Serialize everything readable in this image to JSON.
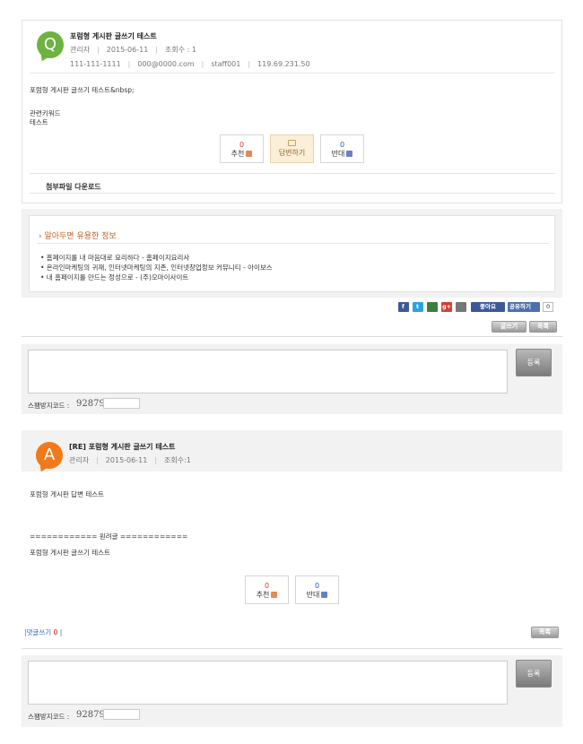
{
  "question": {
    "avatar_letter": "Q",
    "avatar_color": "#6db33f",
    "title": "포럼형 게시판 글쓰기 테스트",
    "author": "관리자",
    "date": "2015-06-11",
    "views": "조회수 : 1",
    "phone": "111-111-1111",
    "email": "000@0000.com",
    "user_id": "staff001",
    "ip": "119.69.231.50",
    "body_line1": "포럼형 게시판 글쓰기 테스트&nbsp;",
    "keywords_label": "관련키워드",
    "keywords_value": "테스트",
    "recommend_count": "0",
    "recommend_label": "추천",
    "reply_label": "답변하기",
    "oppose_count": "0",
    "oppose_label": "반대",
    "attachment_label": "첨부파일 다운로드"
  },
  "info": {
    "title": "› 알아두면 유용한 정보",
    "items": [
      "• 홈페이지를 내 마음대로 요리하다 - 홈페이지요리사",
      "• 온라인마케팅의 귀재, 인터넷마케팅의 지존, 인터넷창업정보 커뮤니티 - 아이보스",
      "• 내 홈페이지를 만드는 정성으로 - (주)오마이사이트"
    ]
  },
  "share": {
    "facebook": "f",
    "twitter": "t",
    "google": "g+",
    "like_label": "좋아요",
    "share_label": "공유하기",
    "share_count": "0",
    "colors": {
      "facebook": "#3b5998",
      "twitter": "#2aa3e0",
      "google": "#d44132",
      "like": "#3b5998",
      "share": "#4d6fad"
    }
  },
  "buttons": {
    "write": "글쓰기",
    "list": "목록",
    "submit": "등록"
  },
  "comment_form": {
    "spam_label": "스팸방지코드 :",
    "spam_code": "92879"
  },
  "answer": {
    "avatar_letter": "A",
    "avatar_color": "#f07a1a",
    "title": "[RE] 포럼형 게시판 글쓰기 테스트",
    "author": "관리자",
    "date": "2015-06-11",
    "views": "조회수:1",
    "body_line1": "포럼형 게시판 답변 테스트",
    "separator": "============ 원려글 ============",
    "original_text": "포럼형 게시판 글쓰기 테스트",
    "recommend_count": "0",
    "recommend_label": "추천",
    "oppose_count": "0",
    "oppose_label": "반대"
  },
  "comments": {
    "label": "|댓글쓰기",
    "count": "0",
    "suffix": "|"
  }
}
